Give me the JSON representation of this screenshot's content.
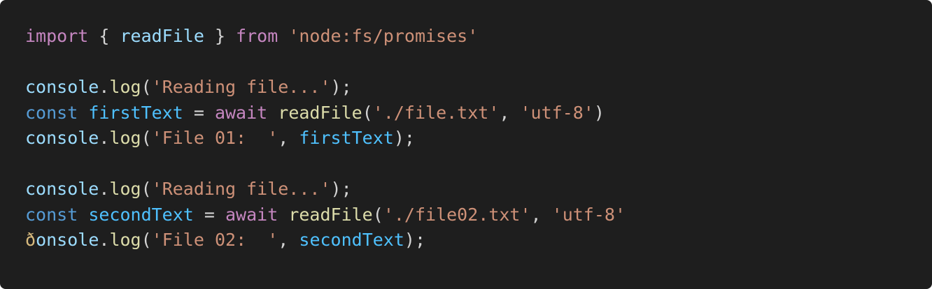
{
  "editor": {
    "background": "#1e1e1e",
    "colors": {
      "keyword_control": "#c586c0",
      "keyword_storage": "#569cd6",
      "variable": "#9cdcfe",
      "constant": "#4fc1ff",
      "function": "#dcdcaa",
      "string": "#ce9178",
      "punctuation": "#d4d4d4"
    },
    "lines": [
      {
        "tokens": [
          {
            "t": "import",
            "c": "kw-import"
          },
          {
            "t": " { ",
            "c": "punc"
          },
          {
            "t": "readFile",
            "c": "var"
          },
          {
            "t": " } ",
            "c": "punc"
          },
          {
            "t": "from",
            "c": "kw-import"
          },
          {
            "t": " ",
            "c": "punc"
          },
          {
            "t": "'node:fs/promises'",
            "c": "str"
          }
        ]
      },
      {
        "tokens": []
      },
      {
        "tokens": [
          {
            "t": "console",
            "c": "var"
          },
          {
            "t": ".",
            "c": "punc"
          },
          {
            "t": "log",
            "c": "fn"
          },
          {
            "t": "(",
            "c": "punc"
          },
          {
            "t": "'Reading file...'",
            "c": "str"
          },
          {
            "t": ");",
            "c": "punc"
          }
        ]
      },
      {
        "tokens": [
          {
            "t": "const",
            "c": "kw-const"
          },
          {
            "t": " ",
            "c": "punc"
          },
          {
            "t": "firstText",
            "c": "var-const"
          },
          {
            "t": " = ",
            "c": "punc"
          },
          {
            "t": "await",
            "c": "kw-await"
          },
          {
            "t": " ",
            "c": "punc"
          },
          {
            "t": "readFile",
            "c": "fn"
          },
          {
            "t": "(",
            "c": "punc"
          },
          {
            "t": "'./file.txt'",
            "c": "str"
          },
          {
            "t": ", ",
            "c": "punc"
          },
          {
            "t": "'utf-8'",
            "c": "str"
          },
          {
            "t": ")",
            "c": "punc"
          }
        ]
      },
      {
        "tokens": [
          {
            "t": "console",
            "c": "var"
          },
          {
            "t": ".",
            "c": "punc"
          },
          {
            "t": "log",
            "c": "fn"
          },
          {
            "t": "(",
            "c": "punc"
          },
          {
            "t": "'File 01:  '",
            "c": "str"
          },
          {
            "t": ", ",
            "c": "punc"
          },
          {
            "t": "firstText",
            "c": "var-const"
          },
          {
            "t": ");",
            "c": "punc"
          }
        ]
      },
      {
        "tokens": []
      },
      {
        "tokens": [
          {
            "t": "console",
            "c": "var"
          },
          {
            "t": ".",
            "c": "punc"
          },
          {
            "t": "log",
            "c": "fn"
          },
          {
            "t": "(",
            "c": "punc"
          },
          {
            "t": "'Reading file...'",
            "c": "str"
          },
          {
            "t": ");",
            "c": "punc"
          }
        ]
      },
      {
        "tokens": [
          {
            "t": "const",
            "c": "kw-const"
          },
          {
            "t": " ",
            "c": "punc"
          },
          {
            "t": "secondText",
            "c": "var-const"
          },
          {
            "t": " = ",
            "c": "punc"
          },
          {
            "t": "await",
            "c": "kw-await"
          },
          {
            "t": " ",
            "c": "punc"
          },
          {
            "t": "readFile",
            "c": "fn"
          },
          {
            "t": "(",
            "c": "punc"
          },
          {
            "t": "'./file02.txt'",
            "c": "str"
          },
          {
            "t": ", ",
            "c": "punc"
          },
          {
            "t": "'utf-8'",
            "c": "str"
          }
        ]
      },
      {
        "tokens": [
          {
            "t": "ð",
            "c": "cursor-glyph"
          },
          {
            "t": "onsole",
            "c": "var"
          },
          {
            "t": ".",
            "c": "punc"
          },
          {
            "t": "log",
            "c": "fn"
          },
          {
            "t": "(",
            "c": "punc"
          },
          {
            "t": "'File 02:  '",
            "c": "str"
          },
          {
            "t": ", ",
            "c": "punc"
          },
          {
            "t": "secondText",
            "c": "var-const"
          },
          {
            "t": ");",
            "c": "punc"
          }
        ]
      }
    ]
  }
}
